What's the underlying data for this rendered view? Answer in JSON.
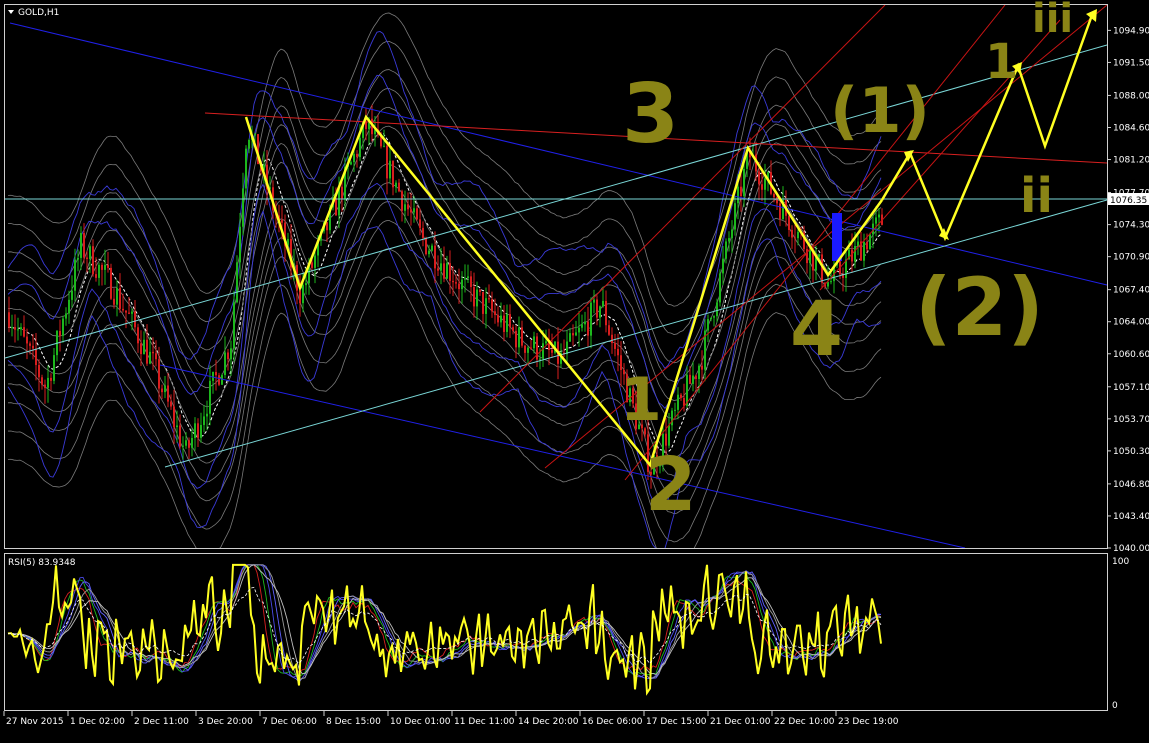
{
  "window": {
    "symbol_label": "GOLD,H1",
    "menu_icon": "triangle-down-icon"
  },
  "chart_data": [
    {
      "type": "line",
      "title": "GOLD,H1",
      "price_axis": {
        "ylim": [
          1040.0,
          1096.0
        ],
        "ticks": [
          "1094.90",
          "1091.50",
          "1088.00",
          "1084.60",
          "1081.20",
          "1077.70",
          "1074.30",
          "1070.90",
          "1067.40",
          "1064.00",
          "1060.60",
          "1057.10",
          "1053.70",
          "1050.30",
          "1046.80",
          "1043.40",
          "1040.00"
        ],
        "current_price": "1076.35"
      },
      "x_ticks": [
        "27 Nov 2015",
        "1 Dec 02:00",
        "2 Dec 11:00",
        "3 Dec 20:00",
        "7 Dec 06:00",
        "8 Dec 15:00",
        "10 Dec 01:00",
        "11 Dec 11:00",
        "14 Dec 20:00",
        "16 Dec 06:00",
        "17 Dec 15:00",
        "21 Dec 01:00",
        "22 Dec 10:00",
        "23 Dec 19:00"
      ],
      "wave_path_prices": [
        {
          "x": "3 Dec 20:00",
          "y": 1085.0
        },
        {
          "x": "7 Dec 06:00",
          "y": 1066.9
        },
        {
          "x": "8 Dec 15:00",
          "y": 1085.0
        },
        {
          "x": "17 Dec 15:00",
          "y": 1048.5
        },
        {
          "x": "21 Dec 01:00",
          "y": 1081.8
        },
        {
          "x": "22 Dec 10:00",
          "y": 1068.0
        },
        {
          "x": "23 Dec 19:00",
          "y": 1074.8
        }
      ],
      "annotations": [
        "3",
        "1",
        "2",
        "4",
        "(1)",
        "(2)",
        "1",
        "ii",
        "iii"
      ]
    },
    {
      "type": "line",
      "title": "RSI(5) 83.9348",
      "ylim": [
        0,
        100
      ],
      "ticks": [
        "100",
        "0"
      ]
    }
  ],
  "colors": {
    "background": "#000000",
    "bull": "#1db81d",
    "bear": "#d81e1e",
    "wave": "#ffff22",
    "channel_blue": "#2020e8",
    "channel_cyan": "#7ad7d7",
    "channel_red": "#c81414",
    "annotation": "#8a8416",
    "rsi": "#ffff22"
  }
}
